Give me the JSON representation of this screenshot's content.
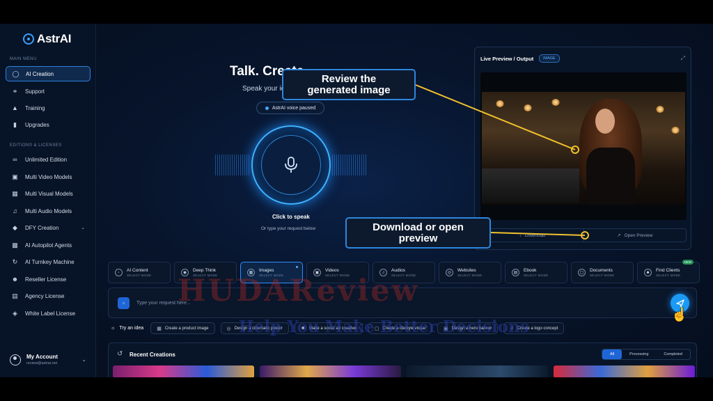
{
  "app": {
    "name": "AstrAI"
  },
  "sidebar": {
    "main_menu_label": "MAIN MENU",
    "main_items": [
      {
        "label": "AI Creation",
        "icon": "chat-bubble-icon",
        "active": true
      },
      {
        "label": "Support",
        "icon": "headset-icon"
      },
      {
        "label": "Training",
        "icon": "graduation-cap-icon"
      },
      {
        "label": "Upgrades",
        "icon": "bar-chart-icon"
      }
    ],
    "editions_label": "EDITIONS & LICENSES",
    "edition_items": [
      {
        "label": "Unlimited Edition",
        "icon": "infinity-icon"
      },
      {
        "label": "Multi Video Models",
        "icon": "video-icon"
      },
      {
        "label": "Multi Visual Models",
        "icon": "image-icon"
      },
      {
        "label": "Multi Audio Models",
        "icon": "music-note-icon"
      },
      {
        "label": "DFY Creation",
        "icon": "cube-icon"
      },
      {
        "label": "AI Autopilot Agents",
        "icon": "robot-icon"
      },
      {
        "label": "AI Turnkey Machine",
        "icon": "refresh-icon"
      },
      {
        "label": "Reseller License",
        "icon": "user-check-icon"
      },
      {
        "label": "Agency License",
        "icon": "building-icon"
      },
      {
        "label": "White Label License",
        "icon": "tag-icon"
      }
    ],
    "account": {
      "name": "My Account",
      "email": "review@astrai.net"
    }
  },
  "hero": {
    "title": "Talk. Create",
    "subtitle": "Speak your id",
    "voice_status": "AstrAI voice paused",
    "click_to_speak": "Click to speak",
    "or_type": "Or type your request below"
  },
  "preview": {
    "title": "Live Preview / Output",
    "badge": "IMAGE",
    "download_label": "Download",
    "open_label": "Open Preview"
  },
  "modes": [
    {
      "name": "AI Content",
      "sub": "SELECT MODE",
      "icon": "chat-icon"
    },
    {
      "name": "Deep Think",
      "sub": "SELECT MODE",
      "icon": "brain-icon"
    },
    {
      "name": "Images",
      "sub": "SELECT MODE",
      "icon": "image-icon",
      "active": true
    },
    {
      "name": "Videos",
      "sub": "SELECT MODE",
      "icon": "video-icon"
    },
    {
      "name": "Audios",
      "sub": "SELECT MODE",
      "icon": "music-note-icon"
    },
    {
      "name": "Websites",
      "sub": "SELECT MODE",
      "icon": "globe-icon"
    },
    {
      "name": "Ebook",
      "sub": "SELECT MODE",
      "icon": "book-icon"
    },
    {
      "name": "Documents",
      "sub": "SELECT MODE",
      "icon": "document-icon"
    },
    {
      "name": "Find Clients",
      "sub": "SELECT MODE",
      "icon": "users-icon",
      "badge": "NEW"
    }
  ],
  "request": {
    "placeholder": "Type your request here..."
  },
  "ideas": {
    "label": "Try an idea",
    "items": [
      "Create a product image",
      "Design a cinematic poster",
      "Make a social ad creative",
      "Create a lifestyle visual",
      "Design a hero banner",
      "Create a logo concept"
    ]
  },
  "recent": {
    "title": "Recent Creations",
    "tabs": [
      "All",
      "Processing",
      "Completed"
    ],
    "active_tab": "All"
  },
  "annotations": {
    "review": "Review the generated image",
    "download": "Download or open preview"
  },
  "watermark": {
    "brand": "HUDAReview",
    "tagline": "Help You Make Better Decisions"
  },
  "colors": {
    "accent": "#2f8fff",
    "send_button": "#1b9af5",
    "callout_border": "#2e86de",
    "arrow": "#f2c12e"
  }
}
